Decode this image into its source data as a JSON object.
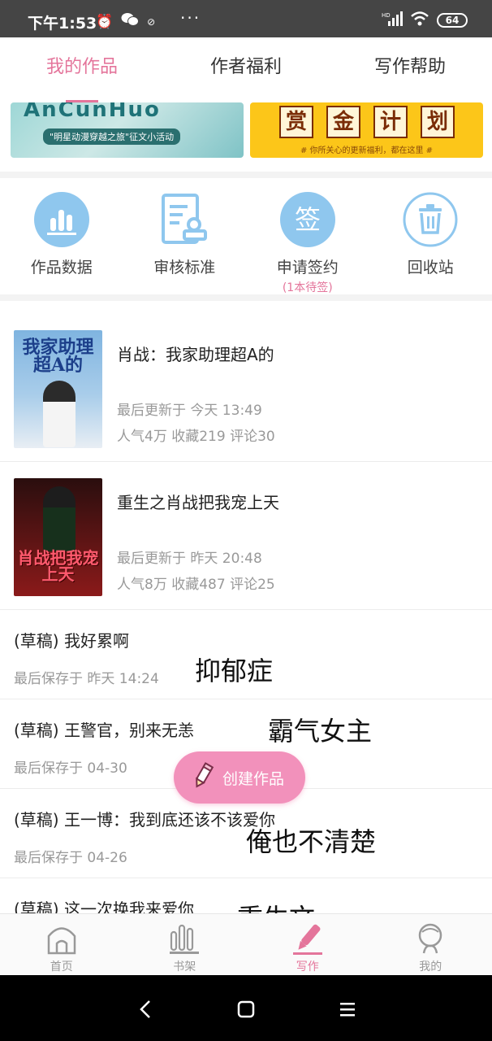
{
  "status_bar": {
    "time": "下午1:53",
    "dots": "···",
    "battery": "64",
    "network": "HD"
  },
  "top_tabs": [
    {
      "label": "我的作品",
      "active": true
    },
    {
      "label": "作者福利",
      "active": false
    },
    {
      "label": "写作帮助",
      "active": false
    }
  ],
  "banners": {
    "left": {
      "title": "AnCunHuo",
      "subtitle": "\"明星动漫穿越之旅\"征文小活动"
    },
    "right": {
      "chars": [
        "赏",
        "金",
        "计",
        "划"
      ],
      "subtitle": "# 你所关心的更新福利，都在这里 #"
    }
  },
  "functions": [
    {
      "label": "作品数据",
      "icon": "chart-icon"
    },
    {
      "label": "审核标准",
      "icon": "document-stamp-icon"
    },
    {
      "label": "申请签约",
      "icon": "sign-icon",
      "icon_text": "签",
      "sub": "(1本待签)"
    },
    {
      "label": "回收站",
      "icon": "trash-icon"
    }
  ],
  "works": [
    {
      "title": "肖战：我家助理超A的",
      "cover_text": "我家助理超A的",
      "updated": "最后更新于 今天 13:49",
      "stats": "人气4万 收藏219 评论30"
    },
    {
      "title": "重生之肖战把我宠上天",
      "cover_text": "肖战把我宠上天",
      "updated": "最后更新于 昨天 20:48",
      "stats": "人气8万 收藏487 评论25"
    }
  ],
  "drafts": [
    {
      "title": "(草稿) 我好累啊",
      "saved": "最后保存于 昨天 14:24",
      "note": "抑郁症"
    },
    {
      "title": "(草稿) 王警官，别来无恙",
      "saved": "最后保存于 04-30",
      "note": "霸气女主"
    },
    {
      "title": "(草稿) 王一博：我到底还该不该爱你",
      "saved": "最后保存于 04-26",
      "note": "俺也不清楚"
    },
    {
      "title": "(草稿) 这一次换我来爱你",
      "saved": "",
      "note": "重生文"
    }
  ],
  "fab": {
    "label": "创建作品"
  },
  "bottom_nav": [
    {
      "label": "首页",
      "icon": "home-icon",
      "active": false
    },
    {
      "label": "书架",
      "icon": "bookshelf-icon",
      "active": false
    },
    {
      "label": "写作",
      "icon": "pen-icon",
      "active": true
    },
    {
      "label": "我的",
      "icon": "profile-icon",
      "active": false
    }
  ],
  "colors": {
    "accent": "#e4759b",
    "fab": "#f291bb",
    "icon_blue": "#8fc7ee",
    "gold": "#fcc619"
  }
}
